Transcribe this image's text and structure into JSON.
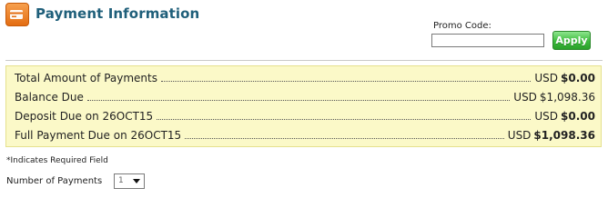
{
  "header": {
    "title": "Payment Information",
    "icon": "credit-card-icon",
    "accent_color": "#1f5f7a"
  },
  "promo": {
    "label": "Promo Code:",
    "value": "",
    "apply_label": "Apply",
    "apply_color": "#3cbb3c"
  },
  "summary": {
    "background": "#fbf9c8",
    "rows": [
      {
        "label": "Total Amount of Payments",
        "currency": "USD",
        "amount": "$0.00",
        "bold": true
      },
      {
        "label": "Balance Due",
        "currency": "USD",
        "amount": "$1,098.36",
        "bold": false
      },
      {
        "label": "Deposit Due on 26OCT15",
        "currency": "USD",
        "amount": "$0.00",
        "bold": true
      },
      {
        "label": "Full Payment Due on 26OCT15",
        "currency": "USD",
        "amount": "$1,098.36",
        "bold": true
      }
    ]
  },
  "form": {
    "required_note": "*Indicates Required Field",
    "payments_label": "Number of Payments",
    "payments_value": "1"
  }
}
